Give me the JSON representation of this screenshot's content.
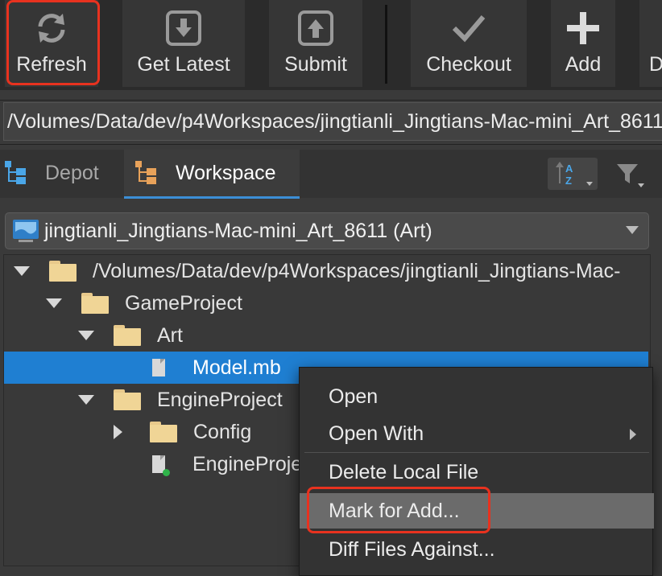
{
  "toolbar": {
    "buttons": [
      {
        "label": "Refresh",
        "icon": "refresh-icon"
      },
      {
        "label": "Get Latest",
        "icon": "download-icon"
      },
      {
        "label": "Submit",
        "icon": "upload-icon"
      },
      {
        "label": "Checkout",
        "icon": "checkmark-icon"
      },
      {
        "label": "Add",
        "icon": "plus-icon"
      },
      {
        "label": "D",
        "icon": "delete-icon"
      }
    ]
  },
  "path_bar": {
    "value": "/Volumes/Data/dev/p4Workspaces/jingtianli_Jingtians-Mac-mini_Art_8611"
  },
  "tabs": [
    {
      "label": "Depot",
      "icon": "depot-icon"
    },
    {
      "label": "Workspace",
      "icon": "workspace-icon"
    }
  ],
  "workspace_select": {
    "value": "jingtianli_Jingtians-Mac-mini_Art_8611 (Art)"
  },
  "tree": {
    "items": [
      {
        "label": "/Volumes/Data/dev/p4Workspaces/jingtianli_Jingtians-Mac-",
        "type": "folder",
        "expanded": true
      },
      {
        "label": "GameProject",
        "type": "folder",
        "expanded": true
      },
      {
        "label": "Art",
        "type": "folder",
        "expanded": true
      },
      {
        "label": "Model.mb",
        "type": "file",
        "selected": true
      },
      {
        "label": "EngineProject",
        "type": "folder",
        "expanded": true
      },
      {
        "label": "Config",
        "type": "folder",
        "expanded": false
      },
      {
        "label": "EngineProje",
        "type": "file-add"
      }
    ]
  },
  "context_menu": {
    "items": [
      {
        "label": "Open"
      },
      {
        "label": "Open With"
      },
      {
        "label": "Delete Local File"
      },
      {
        "label": "Mark for Add..."
      },
      {
        "label": "Diff Files Against..."
      }
    ]
  },
  "colors": {
    "accent": "#1f7fd2",
    "highlight": "#e8321f",
    "background": "#3a3a3a"
  }
}
